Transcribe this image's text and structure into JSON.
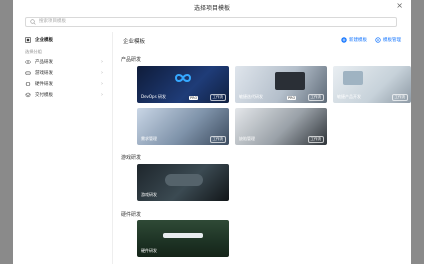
{
  "dialog": {
    "title": "选择项目模板",
    "close": "×"
  },
  "search": {
    "placeholder": "搜索项目模板"
  },
  "sidebar": {
    "enterprise": "企业模板",
    "group_label": "选择分组",
    "items": [
      {
        "label": "产品研发"
      },
      {
        "label": "游戏研发"
      },
      {
        "label": "硬件研发"
      },
      {
        "label": "交付模板"
      }
    ]
  },
  "main": {
    "title": "企业模板",
    "new_template": "新建模板",
    "manage_template": "模板管理",
    "sections": {
      "product": "产品研发",
      "game": "游戏研发",
      "hardware": "硬件研发"
    },
    "cards": [
      {
        "label": "DevOps 研发",
        "pro": "PRO",
        "tag": "工作流"
      },
      {
        "label": "敏捷迭代研发",
        "pro": "PRO",
        "tag": "工作流"
      },
      {
        "label": "敏捷产品开发",
        "tag": "工作流"
      },
      {
        "label": "需求管理",
        "tag": "工作流"
      },
      {
        "label": "缺陷管理",
        "tag": "工作流"
      },
      {
        "label": "游戏研发"
      },
      {
        "label": "硬件研发"
      }
    ]
  }
}
